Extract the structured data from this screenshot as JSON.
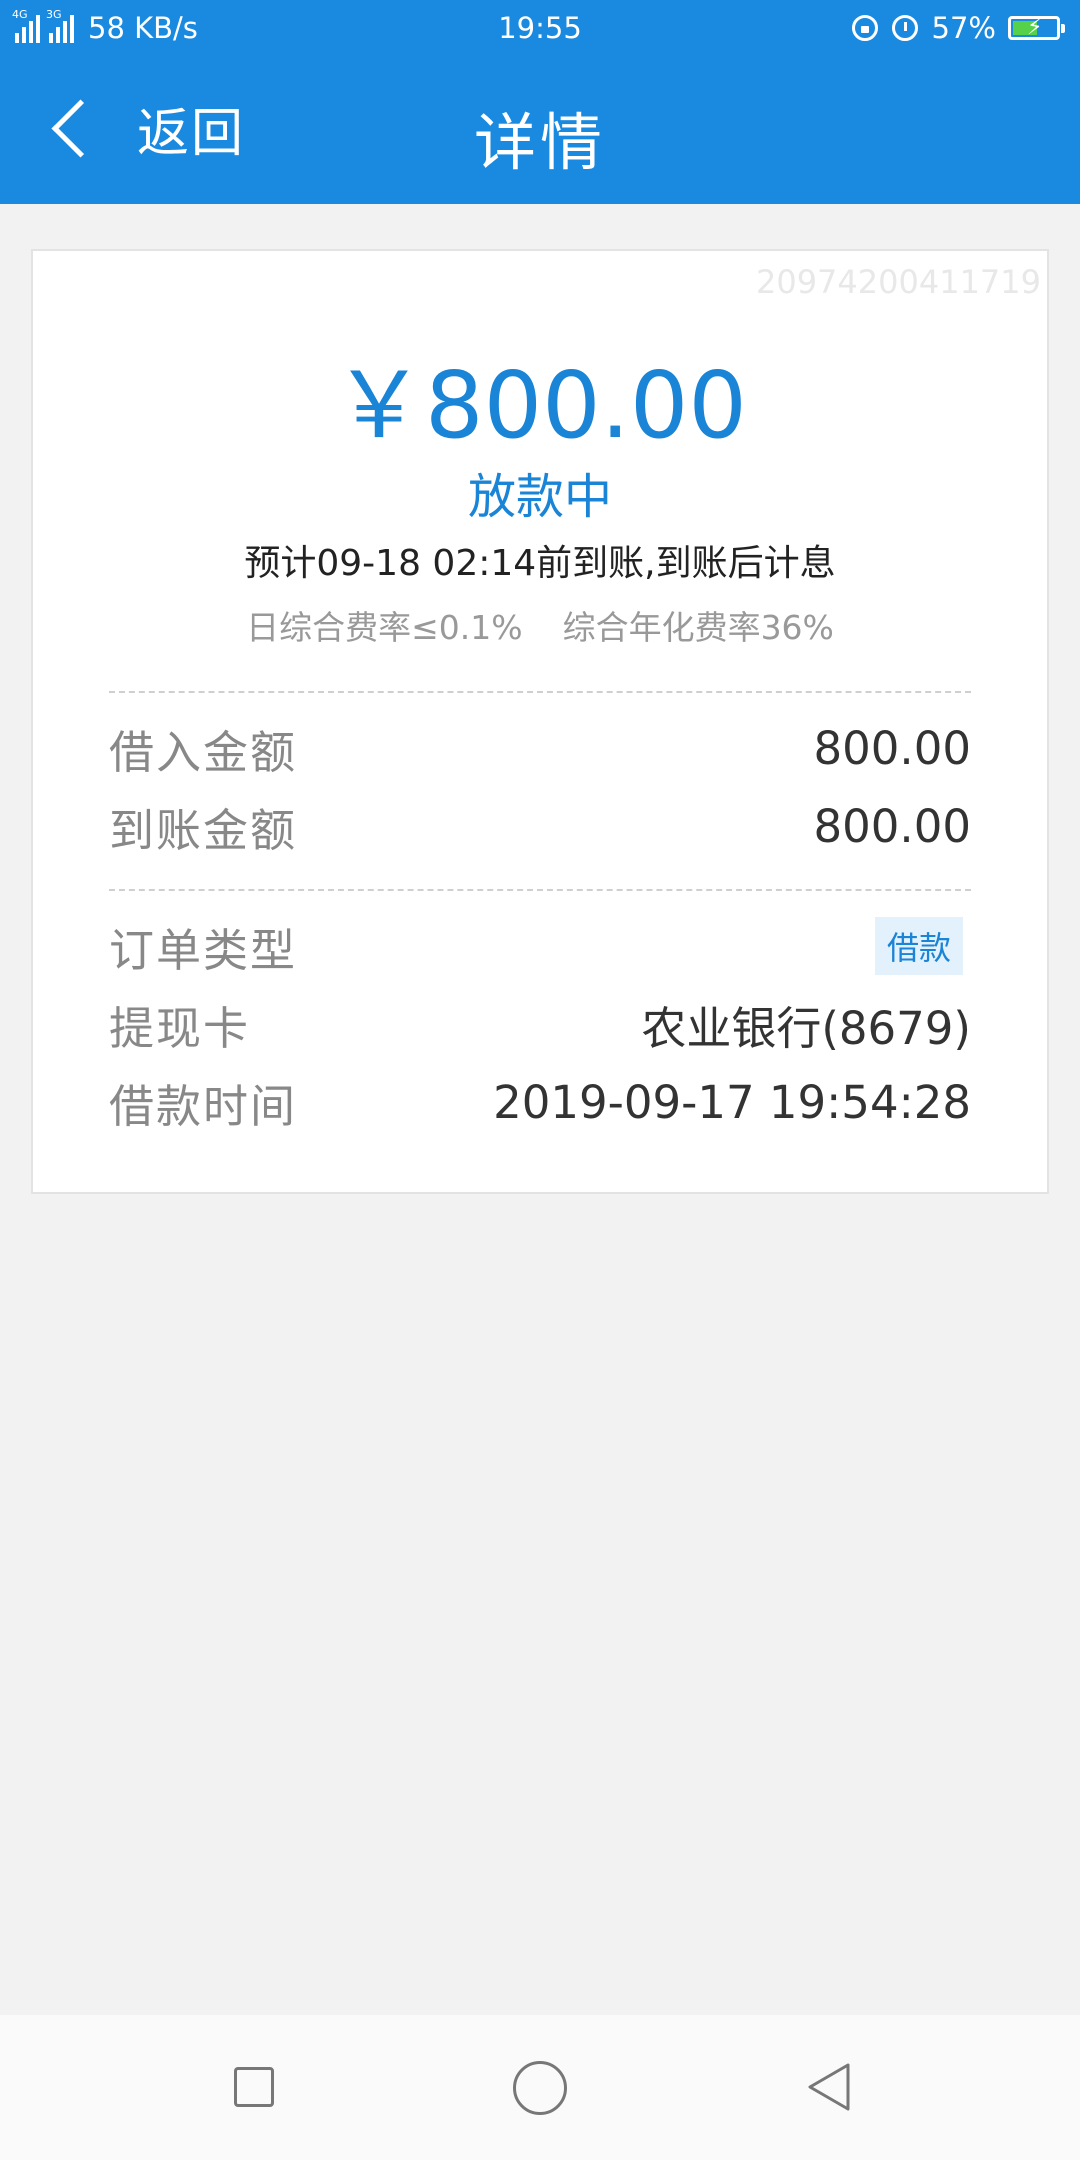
{
  "status_bar": {
    "network_tag_1": "4G",
    "network_tag_2": "3G",
    "speed": "58 KB/s",
    "time": "19:55",
    "battery": "57%",
    "battery_level": 0.57
  },
  "header": {
    "back_label": "返回",
    "title": "详情",
    "bg_color": "#1a8ae0"
  },
  "card": {
    "order_number": "20974200411719",
    "amount": "￥800.00",
    "status": "放款中",
    "eta": "预计09-18 02:14前到账,到账后计息",
    "daily_rate": "日综合费率≤0.1%",
    "annual_rate": "综合年化费率36%",
    "accent_color": "#1a84d6"
  },
  "details": {
    "borrowed_label": "借入金额",
    "borrowed_value": "800.00",
    "received_label": "到账金额",
    "received_value": "800.00",
    "order_type_label": "订单类型",
    "order_type_value": "借款",
    "card_label": "提现卡",
    "card_value": "农业银行(8679)",
    "time_label": "借款时间",
    "time_value": "2019-09-17 19:54:28"
  },
  "nav_bar": {
    "icons": [
      "recent-apps-icon",
      "home-icon",
      "back-icon"
    ]
  }
}
